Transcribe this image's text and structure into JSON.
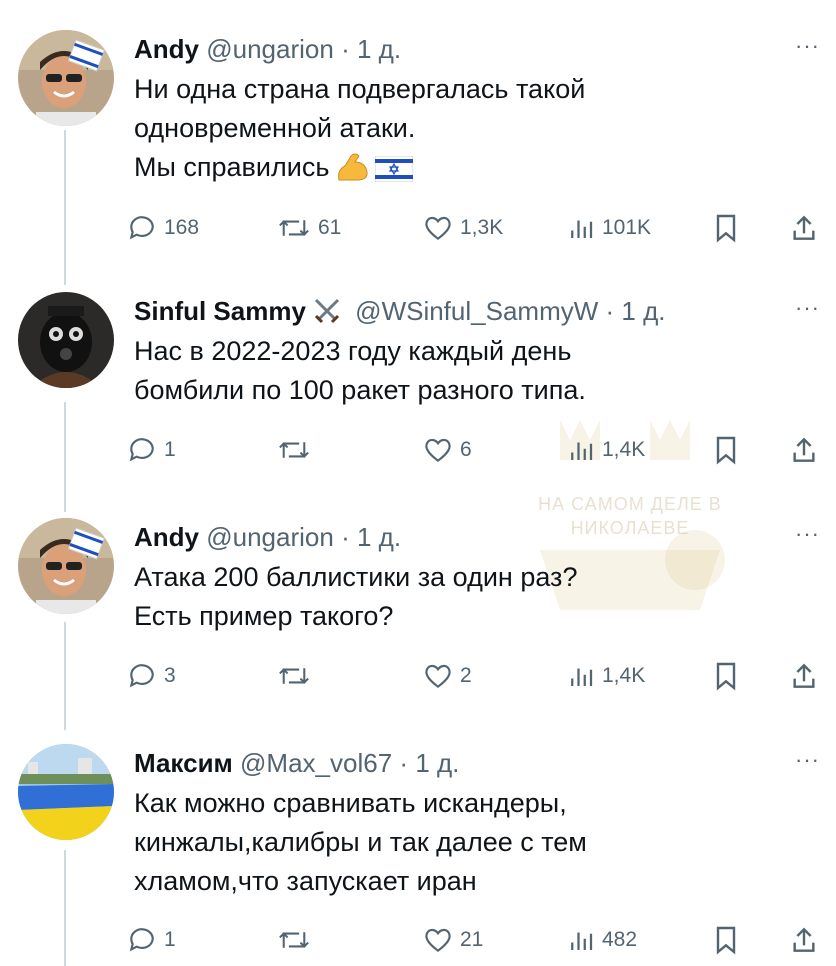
{
  "tweets": [
    {
      "name": "Andy",
      "handle": "@ungarion",
      "sep": "·",
      "time": "1 д.",
      "lines": [
        "Ни одна страна подвергалась такой",
        "одновременной атаки.",
        "Мы справились"
      ],
      "emojis": [
        "flexed-biceps",
        "israel-flag"
      ],
      "stats": {
        "replies": "168",
        "reposts": "61",
        "likes": "1,3K",
        "views": "101K"
      }
    },
    {
      "name": "Sinful Sammy",
      "handle": "@WSinful_SammyW",
      "sep": "·",
      "time": "1 д.",
      "lines": [
        "Нас в 2022-2023 году каждый день",
        "бомбили по 100 ракет разного типа."
      ],
      "stats": {
        "replies": "1",
        "reposts": "",
        "likes": "6",
        "views": "1,4K"
      }
    },
    {
      "name": "Andy",
      "handle": "@ungarion",
      "sep": "·",
      "time": "1 д.",
      "lines": [
        "Атака 200 баллистики за один раз?",
        "Есть пример такого?"
      ],
      "stats": {
        "replies": "3",
        "reposts": "",
        "likes": "2",
        "views": "1,4K"
      }
    },
    {
      "name": "Максим",
      "handle": "@Max_vol67",
      "sep": "·",
      "time": "1 д.",
      "lines": [
        "Как можно сравнивать искандеры,",
        "кинжалы,калибры и так далее с тем",
        "хламом,что запускает иран"
      ],
      "stats": {
        "replies": "1",
        "reposts": "",
        "likes": "21",
        "views": "482"
      }
    }
  ],
  "more_label": "···",
  "watermark": {
    "line1": "НА САМОМ ДЕЛЕ В",
    "line2": "НИКОЛАЕВЕ"
  },
  "colors": {
    "text": "#0f1419",
    "muted": "#536471",
    "line": "#cfd9de"
  }
}
